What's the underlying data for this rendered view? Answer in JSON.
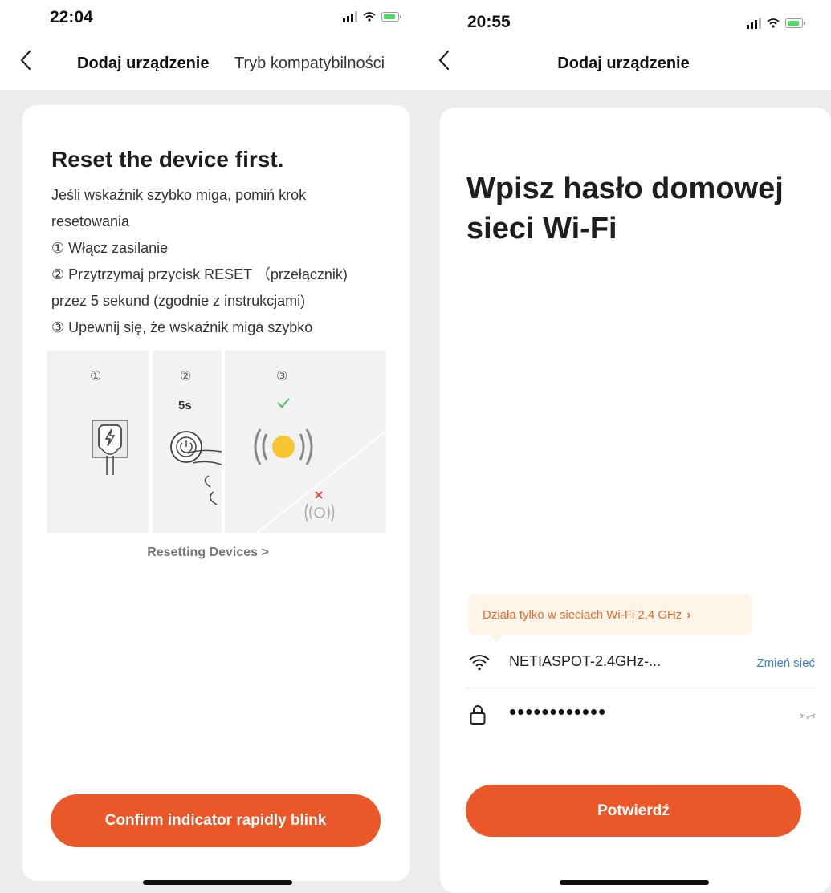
{
  "left": {
    "status_time": "22:04",
    "nav_title": "Dodaj urządzenie",
    "nav_action": "Tryb kompatybilności",
    "heading": "Reset the device first.",
    "instructions": [
      "Jeśli wskaźnik szybko miga, pomiń krok",
      "resetowania",
      "① Włącz zasilanie",
      "② Przytrzymaj przycisk RESET （przełącznik)",
      "przez 5 sekund (zgodnie z instrukcjami)",
      "③ Upewnij się, że wskaźnik miga szybko"
    ],
    "steps": [
      {
        "number": "①",
        "icon": "power-plug-icon"
      },
      {
        "number": "②",
        "label": "5s",
        "icon": "power-button-press-icon"
      },
      {
        "number": "③",
        "icon": "blinking-indicator-icon"
      }
    ],
    "reset_link": "Resetting Devices >",
    "confirm_button": "Confirm indicator rapidly blink"
  },
  "right": {
    "status_time": "20:55",
    "nav_title": "Dodaj urządzenie",
    "heading_line1": "Wpisz hasło domowej",
    "heading_line2": "sieci Wi-Fi",
    "notice": "Działa tylko w sieciach Wi-Fi 2,4 GHz",
    "notice_chevron": "›",
    "network_name": "NETIASPOT-2.4GHz-...",
    "change_network": "Zmień sieć",
    "password_masked": "••••••••••••",
    "confirm_button": "Potwierdź"
  },
  "colors": {
    "accent": "#ea5829",
    "link_blue": "#3a7bd5",
    "notice_bg": "#fff4e8",
    "notice_text": "#e56a2c",
    "check_green": "#55c26b",
    "cross_red": "#e24c4c",
    "led_yellow": "#f6c531"
  }
}
